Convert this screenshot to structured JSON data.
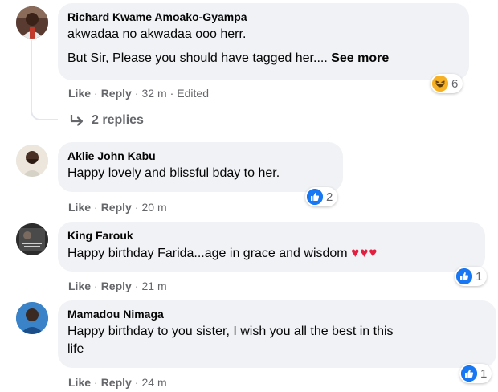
{
  "colors": {
    "bubble_bg": "#f0f2f5",
    "meta_text": "#65676b",
    "like_blue": "#1877f2",
    "heart_red": "#e41e3f",
    "haha_yellow": "#f7b125"
  },
  "comments": [
    {
      "author": "Richard Kwame Amoako-Gyampa",
      "line1": "akwadaa no akwadaa ooo herr.",
      "line2": "But Sir, Please you should have tagged her....",
      "see_more": "See more",
      "like": "Like",
      "reply": "Reply",
      "time": "32 m",
      "edited": "Edited",
      "reaction_icon": "haha-icon",
      "reaction_count": "6",
      "replies": "2 replies"
    },
    {
      "author": "Aklie John Kabu",
      "text": "Happy lovely and blissful bday to her.",
      "like": "Like",
      "reply": "Reply",
      "time": "20 m",
      "reaction_icon": "like-icon",
      "reaction_count": "2"
    },
    {
      "author": "King Farouk",
      "text": "Happy birthday Farida...age in grace and wisdom",
      "emoji": "♥♥♥",
      "like": "Like",
      "reply": "Reply",
      "time": "21 m",
      "reaction_icon": "like-icon",
      "reaction_count": "1"
    },
    {
      "author": "Mamadou Nimaga",
      "line1": "Happy birthday to you sister, I wish you all the best in this",
      "line2": "life",
      "like": "Like",
      "reply": "Reply",
      "time": "24 m",
      "reaction_icon": "like-icon",
      "reaction_count": "1"
    }
  ]
}
